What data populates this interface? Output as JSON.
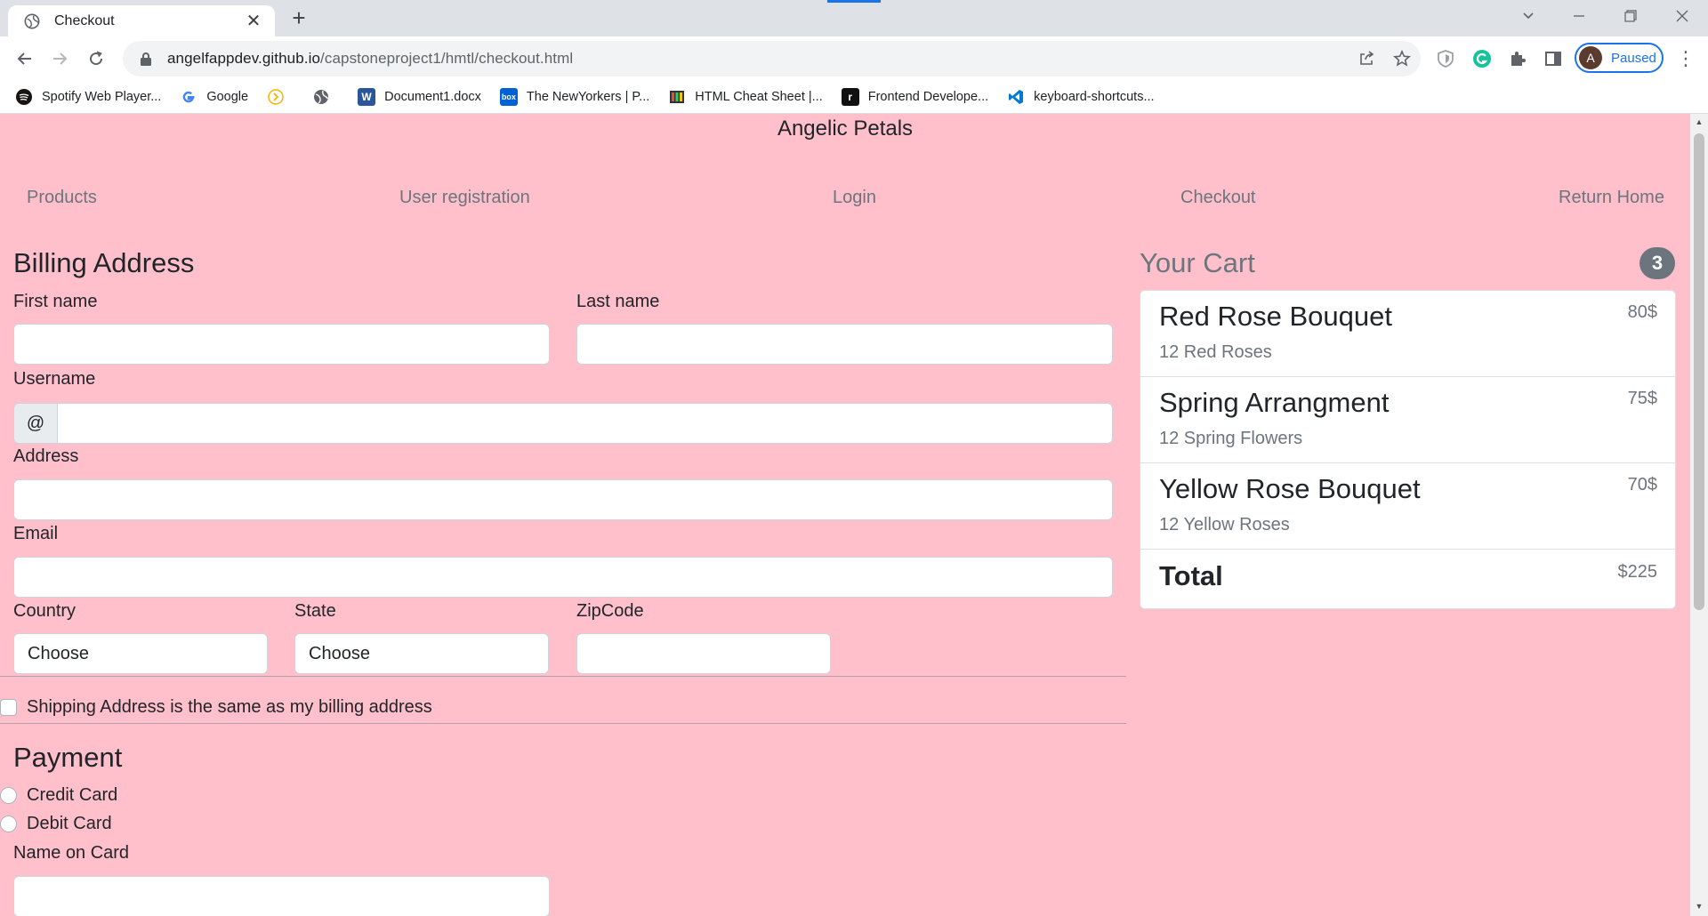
{
  "browser": {
    "tab_title": "Checkout",
    "tab_close": "✕",
    "new_tab": "+",
    "url_domain": "angelfappdev.github.io",
    "url_path": "/capstoneproject1/hmtl/checkout.html",
    "profile_initial": "A",
    "profile_status": "Paused",
    "accent_color": "#1a73e8"
  },
  "bookmarks": [
    {
      "label": "Spotify Web Player...",
      "icon": "spotify-icon",
      "color": "#191414"
    },
    {
      "label": "Google",
      "icon": "google-icon",
      "color": "#4285f4"
    },
    {
      "label": "",
      "icon": "arrow-circle-icon",
      "color": "#f4b400"
    },
    {
      "label": "",
      "icon": "globe-icon",
      "color": "#5f6368"
    },
    {
      "label": "Document1.docx",
      "icon": "word-icon",
      "color": "#2b579a"
    },
    {
      "label": "The NewYorkers | P...",
      "icon": "box-icon",
      "color": "#0061d5"
    },
    {
      "label": "HTML Cheat Sheet |...",
      "icon": "cheatsheet-icon",
      "color": "#c0392b"
    },
    {
      "label": "Frontend Develope...",
      "icon": "frontend-icon",
      "color": "#111111"
    },
    {
      "label": "keyboard-shortcuts...",
      "icon": "vscode-icon",
      "color": "#0078d4"
    }
  ],
  "page": {
    "background": "#ffc0cb",
    "brand": "Angelic Petals",
    "nav": [
      "Products",
      "User registration",
      "Login",
      "Checkout",
      "Return Home"
    ]
  },
  "billing": {
    "heading": "Billing Address",
    "first_name_label": "First name",
    "last_name_label": "Last name",
    "username_label": "Username",
    "username_prefix": "@",
    "address_label": "Address",
    "email_label": "Email",
    "country_label": "Country",
    "country_value": "Choose",
    "state_label": "State",
    "state_value": "Choose",
    "zip_label": "ZipCode",
    "same_address_label": "Shipping Address is the same as my billing address"
  },
  "payment": {
    "heading": "Payment",
    "options": [
      "Credit Card",
      "Debit Card"
    ],
    "name_on_card_label": "Name on Card"
  },
  "cart": {
    "title": "Your Cart",
    "count": "3",
    "items": [
      {
        "name": "Red Rose Bouquet",
        "desc": "12 Red Roses",
        "price": "80$"
      },
      {
        "name": "Spring Arrangment",
        "desc": "12 Spring Flowers",
        "price": "75$"
      },
      {
        "name": "Yellow Rose Bouquet",
        "desc": "12 Yellow Roses",
        "price": "70$"
      }
    ],
    "total_label": "Total",
    "total_value": "$225"
  }
}
